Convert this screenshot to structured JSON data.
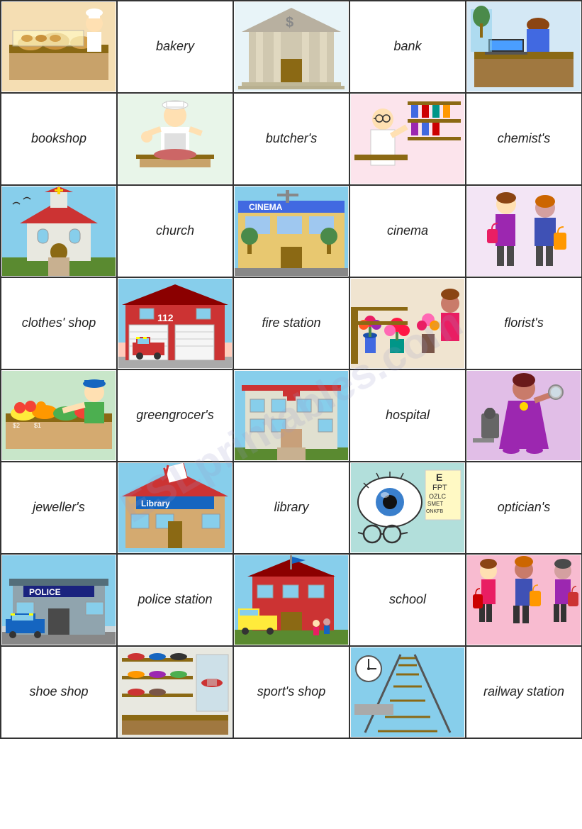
{
  "watermark": "ESLprintables.com",
  "rows": [
    [
      {
        "type": "image",
        "id": "bakery-image",
        "color": "#f5deb3",
        "icon": "bakery"
      },
      {
        "type": "label",
        "id": "bakery-label",
        "text": "bakery"
      },
      {
        "type": "image",
        "id": "bank-image",
        "color": "#e8e8e8",
        "icon": "bank"
      },
      {
        "type": "label",
        "id": "bank-label",
        "text": "bank"
      },
      {
        "type": "image",
        "id": "bank-worker-image",
        "color": "#d4e8f5",
        "icon": "bank-worker"
      }
    ],
    [
      {
        "type": "label",
        "id": "bookshop-label",
        "text": "bookshop"
      },
      {
        "type": "image",
        "id": "butcher-image",
        "color": "#e8f5e9",
        "icon": "butcher"
      },
      {
        "type": "label",
        "id": "butchers-label",
        "text": "butcher's"
      },
      {
        "type": "image",
        "id": "chemist-image",
        "color": "#fce4ec",
        "icon": "chemist"
      },
      {
        "type": "label",
        "id": "chemists-label",
        "text": "chemist's"
      }
    ],
    [
      {
        "type": "image",
        "id": "church-image",
        "color": "#e3f2fd",
        "icon": "church"
      },
      {
        "type": "label",
        "id": "church-label",
        "text": "church"
      },
      {
        "type": "image",
        "id": "cinema-image",
        "color": "#ffe0b2",
        "icon": "cinema"
      },
      {
        "type": "label",
        "id": "cinema-label",
        "text": "cinema"
      },
      {
        "type": "image",
        "id": "cinema2-image",
        "color": "#f3e5f5",
        "icon": "cinema-person"
      }
    ],
    [
      {
        "type": "label",
        "id": "clothes-label",
        "text": "clothes' shop"
      },
      {
        "type": "image",
        "id": "fire-image",
        "color": "#ffccbc",
        "icon": "fire-station"
      },
      {
        "type": "label",
        "id": "firestation-label",
        "text": "fire station"
      },
      {
        "type": "image",
        "id": "florist-image",
        "color": "#f8bbd0",
        "icon": "florist"
      },
      {
        "type": "label",
        "id": "florists-label",
        "text": "florist's"
      }
    ],
    [
      {
        "type": "image",
        "id": "greengrocer-image",
        "color": "#c8e6c9",
        "icon": "greengrocer"
      },
      {
        "type": "label",
        "id": "greengrocer-label",
        "text": "greengrocer's"
      },
      {
        "type": "image",
        "id": "hospital-image",
        "color": "#ffcdd2",
        "icon": "hospital"
      },
      {
        "type": "label",
        "id": "hospital-label",
        "text": "hospital"
      },
      {
        "type": "image",
        "id": "hospital2-image",
        "color": "#e1bee7",
        "icon": "shopper"
      }
    ],
    [
      {
        "type": "label",
        "id": "jeweller-label",
        "text": "jeweller's"
      },
      {
        "type": "image",
        "id": "library-image",
        "color": "#bbdefb",
        "icon": "library"
      },
      {
        "type": "label",
        "id": "library-label",
        "text": "library"
      },
      {
        "type": "image",
        "id": "optician-image",
        "color": "#b2dfdb",
        "icon": "optician"
      },
      {
        "type": "label",
        "id": "opticians-label",
        "text": "optician's"
      }
    ],
    [
      {
        "type": "image",
        "id": "police-image",
        "color": "#cfd8dc",
        "icon": "police"
      },
      {
        "type": "label",
        "id": "police-label",
        "text": "police station"
      },
      {
        "type": "image",
        "id": "school-image",
        "color": "#ffe082",
        "icon": "school"
      },
      {
        "type": "label",
        "id": "school-label",
        "text": "school"
      },
      {
        "type": "image",
        "id": "school2-image",
        "color": "#f8bbd0",
        "icon": "shoppers"
      }
    ],
    [
      {
        "type": "label",
        "id": "shoeshop-label",
        "text": "shoe shop"
      },
      {
        "type": "image",
        "id": "shoeshop-image",
        "color": "#eceff1",
        "icon": "shoe-shop"
      },
      {
        "type": "label",
        "id": "sportsshop-label",
        "text": "sport's shop"
      },
      {
        "type": "image",
        "id": "railway-image",
        "color": "#b3e5fc",
        "icon": "railway"
      },
      {
        "type": "label",
        "id": "railway-label",
        "text": "railway\nstation"
      }
    ]
  ]
}
